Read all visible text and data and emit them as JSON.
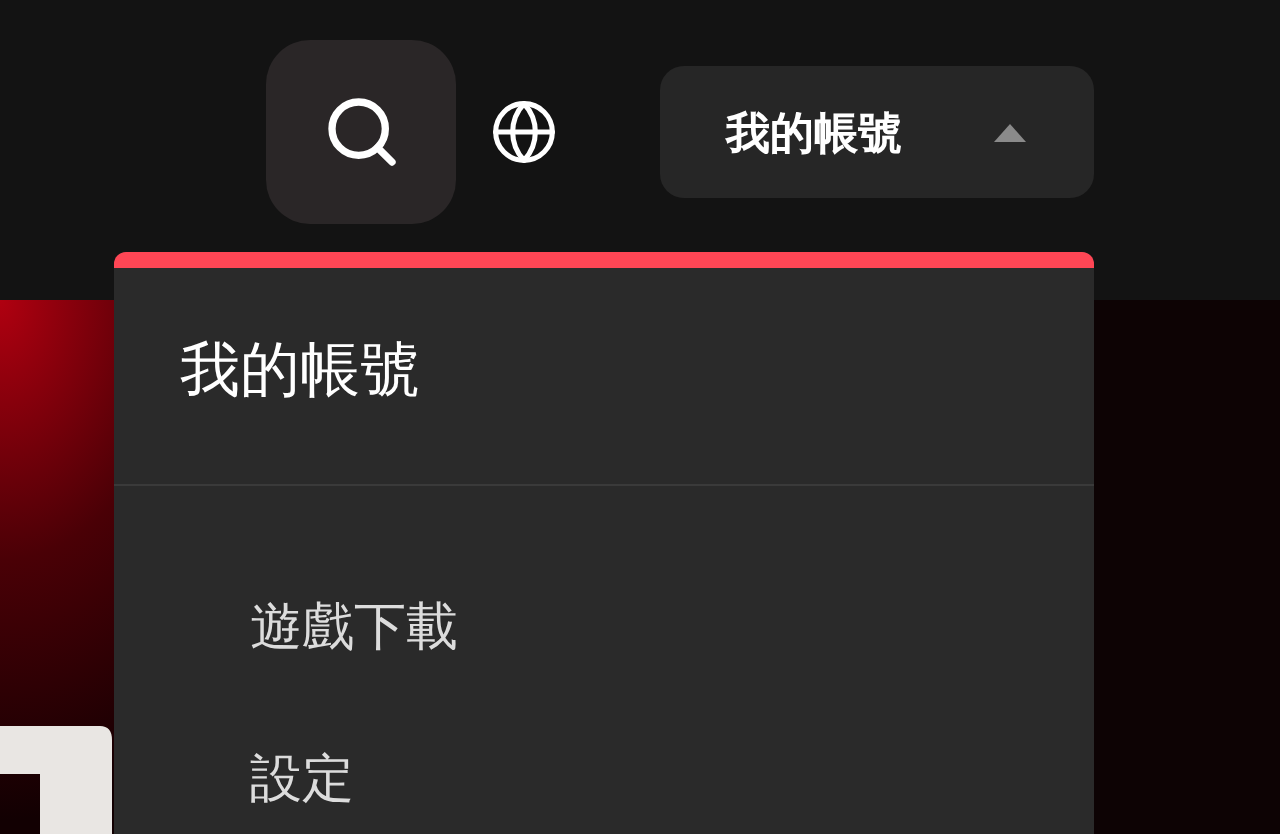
{
  "header": {
    "account_button": {
      "label": "我的帳號",
      "expanded": true
    }
  },
  "account_menu": {
    "title": "我的帳號",
    "items": [
      {
        "label": "遊戲下載"
      },
      {
        "label": "設定"
      }
    ]
  }
}
